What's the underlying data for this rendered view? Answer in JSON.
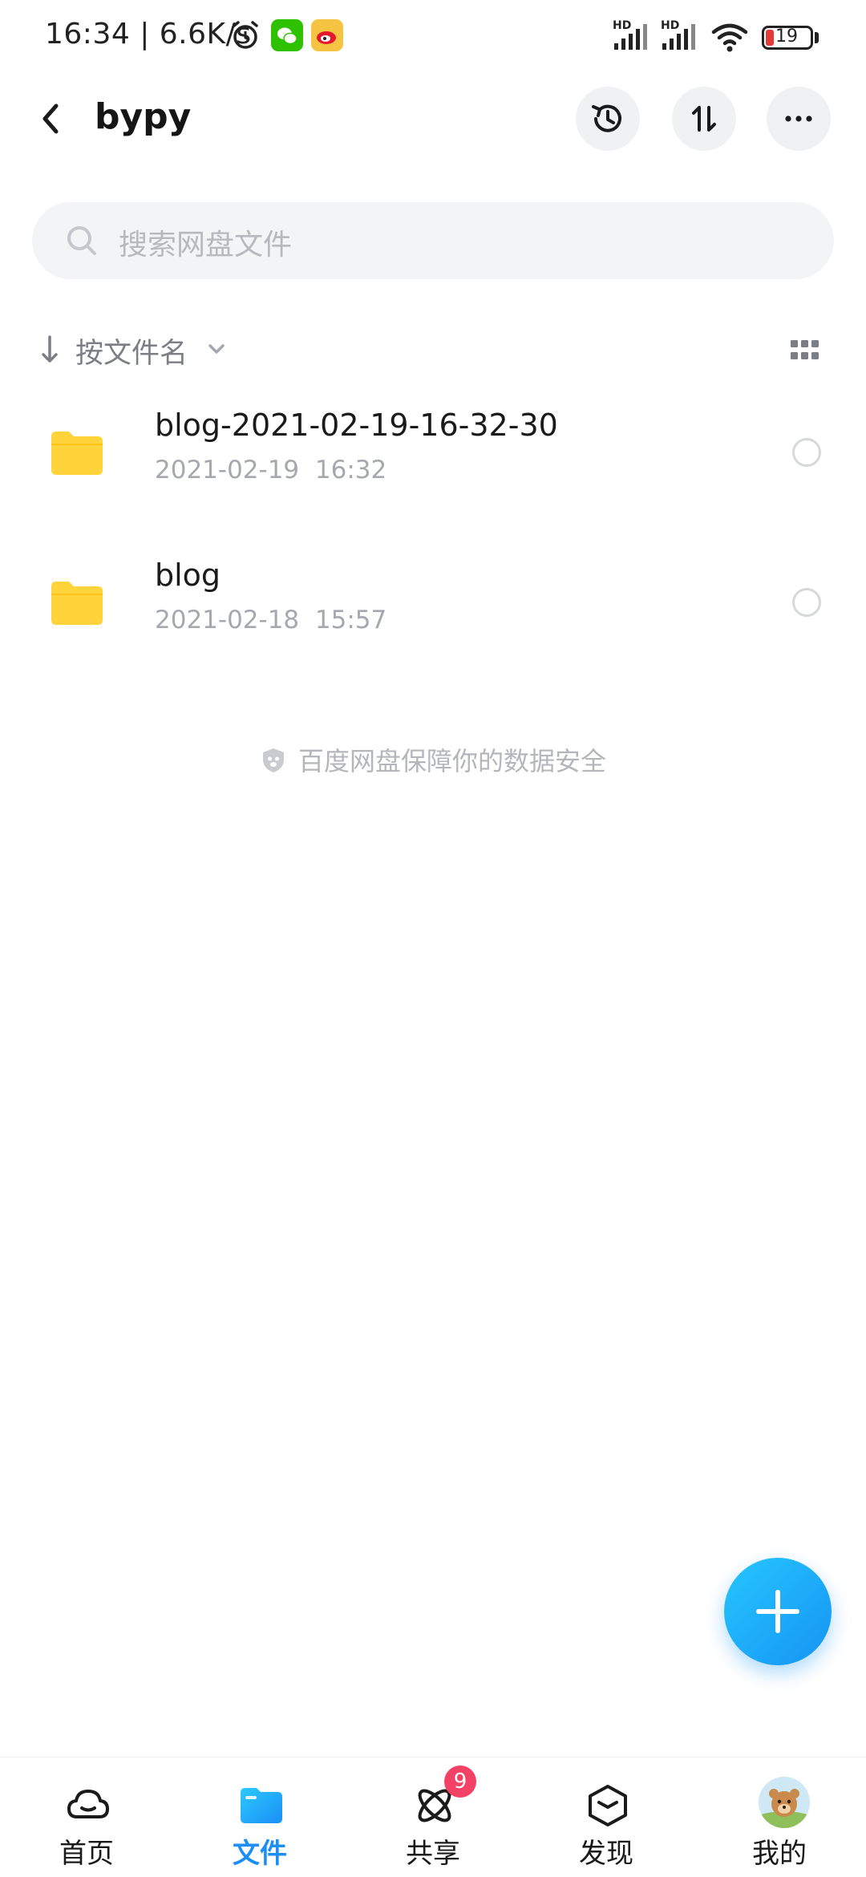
{
  "status_bar": {
    "time": "16:34 | 6.6K/s",
    "hd_label": "HD",
    "battery": "19"
  },
  "header": {
    "title": "bypy"
  },
  "search": {
    "placeholder": "搜索网盘文件"
  },
  "sort": {
    "label": "按文件名"
  },
  "files": [
    {
      "name": "blog-2021-02-19-16-32-30",
      "date": "2021-02-19",
      "time": "16:32"
    },
    {
      "name": "blog",
      "date": "2021-02-18",
      "time": "15:57"
    }
  ],
  "footer_note": "百度网盘保障你的数据安全",
  "bottom_nav": {
    "items": [
      {
        "label": "首页"
      },
      {
        "label": "文件"
      },
      {
        "label": "共享",
        "badge": "9"
      },
      {
        "label": "发现"
      },
      {
        "label": "我的"
      }
    ]
  },
  "colors": {
    "accent": "#1b8ff5",
    "folder": "#ffd43b",
    "badge": "#f44266"
  }
}
